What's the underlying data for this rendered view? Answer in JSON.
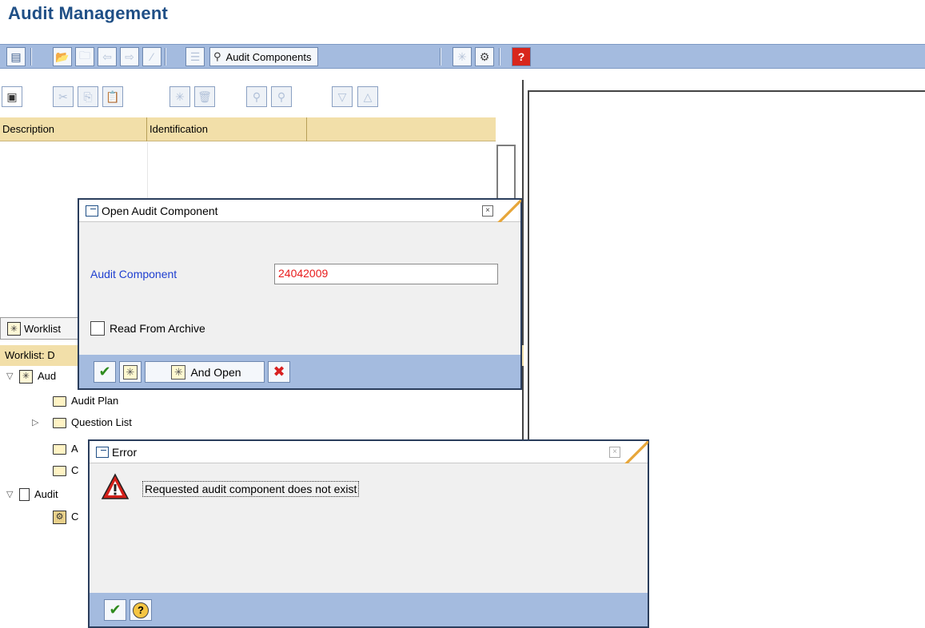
{
  "app": {
    "title": "Audit Management"
  },
  "toolbar": {
    "audit_components_label": "Audit Components"
  },
  "grid": {
    "columns": [
      "Description",
      "Identification",
      ""
    ]
  },
  "worklist": {
    "tab_label": "Worklist",
    "subheader": "Worklist: D",
    "items": [
      {
        "label": "Aud",
        "type": "audit"
      },
      {
        "label": "Audit Plan",
        "type": "folder"
      },
      {
        "label": "Question List",
        "type": "folder"
      },
      {
        "label": "A",
        "type": "folder"
      },
      {
        "label": "C",
        "type": "folder"
      },
      {
        "label": "Audit",
        "type": "doc"
      },
      {
        "label": "C",
        "type": "special"
      }
    ]
  },
  "open_dialog": {
    "title": "Open Audit Component",
    "field_label": "Audit Component",
    "field_value": "24042009",
    "checkbox_label": "Read From Archive",
    "and_open_label": "And Open"
  },
  "error_dialog": {
    "title": "Error",
    "message": "Requested audit component does not exist"
  }
}
